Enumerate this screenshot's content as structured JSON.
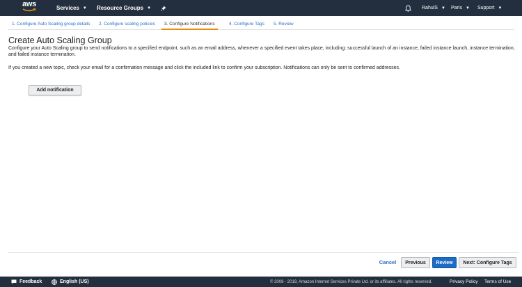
{
  "topnav": {
    "logo_text": "aws",
    "services": "Services",
    "resource_groups": "Resource Groups",
    "user": "RahulS",
    "region": "Paris",
    "support": "Support"
  },
  "steps": [
    {
      "label": "1. Configure Auto Scaling group details",
      "active": false
    },
    {
      "label": "2. Configure scaling policies",
      "active": false
    },
    {
      "label": "3. Configure Notifications",
      "active": true
    },
    {
      "label": "4. Configure Tags",
      "active": false
    },
    {
      "label": "5. Review",
      "active": false
    }
  ],
  "main": {
    "title": "Create Auto Scaling Group",
    "description": "Configure your Auto Scaling group to send notifications to a specified endpoint, such as an email address, whenever a specified event takes place, including: successful launch of an instance, failed instance launch, instance termination, and failed instance termination.",
    "note": "If you created a new topic, check your email for a confirmation message and click the included link to confirm your subscription. Notifications can only be sent to confirmed addresses.",
    "add_notification_label": "Add notification"
  },
  "actions": {
    "cancel": "Cancel",
    "previous": "Previous",
    "review": "Review",
    "next": "Next: Configure Tags"
  },
  "footer": {
    "feedback": "Feedback",
    "language": "English (US)",
    "copyright": "© 2008 - 2019, Amazon Internet Services Private Ltd. or its affiliates. All rights reserved.",
    "privacy": "Privacy Policy",
    "terms": "Terms of Use"
  },
  "colors": {
    "nav_bg": "#232f3e",
    "link": "#2a6ec7",
    "primary": "#1d6bc4",
    "active_tab_underline": "#e88e0c"
  }
}
